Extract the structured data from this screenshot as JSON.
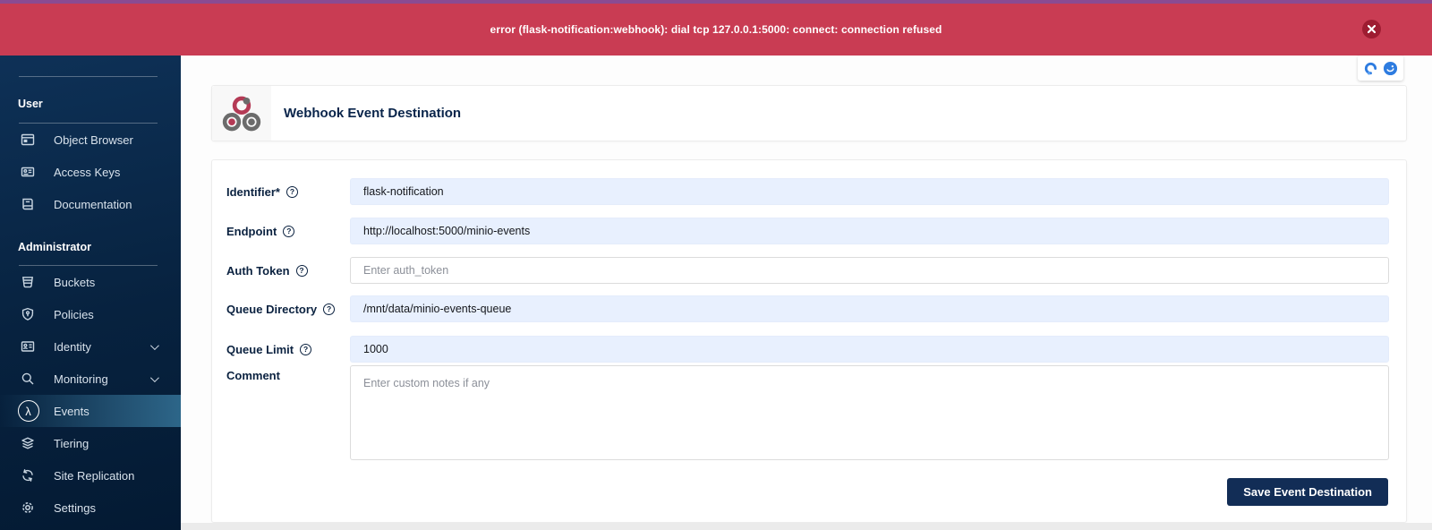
{
  "banner": {
    "message": "error (flask-notification:webhook): dial tcp 127.0.0.1:5000: connect: connection refused",
    "close_icon": "close-icon"
  },
  "sidebar": {
    "sections": [
      {
        "label": "User",
        "items": [
          {
            "label": "Object Browser",
            "icon": "object-browser-icon"
          },
          {
            "label": "Access Keys",
            "icon": "access-keys-icon"
          },
          {
            "label": "Documentation",
            "icon": "documentation-icon"
          }
        ]
      },
      {
        "label": "Administrator",
        "items": [
          {
            "label": "Buckets",
            "icon": "buckets-icon"
          },
          {
            "label": "Policies",
            "icon": "policies-icon"
          },
          {
            "label": "Identity",
            "icon": "identity-icon",
            "chevron": true
          },
          {
            "label": "Monitoring",
            "icon": "monitoring-icon",
            "chevron": true
          },
          {
            "label": "Events",
            "icon": "lambda-icon",
            "selected": true
          },
          {
            "label": "Tiering",
            "icon": "tiering-icon"
          },
          {
            "label": "Site Replication",
            "icon": "site-replication-icon"
          },
          {
            "label": "Settings",
            "icon": "settings-icon"
          }
        ]
      }
    ]
  },
  "header": {
    "title": "Webhook Event Destination",
    "icon": "webhook-icon"
  },
  "form": {
    "fields": [
      {
        "label": "Identifier*",
        "has_help": true,
        "value": "flask-notification",
        "filled": true
      },
      {
        "label": "Endpoint",
        "has_help": true,
        "value": "http://localhost:5000/minio-events",
        "filled": true
      },
      {
        "label": "Auth Token",
        "has_help": true,
        "value": "",
        "placeholder": "Enter auth_token",
        "filled": false
      },
      {
        "label": "Queue Directory",
        "has_help": true,
        "value": "/mnt/data/minio-events-queue",
        "filled": true
      },
      {
        "label": "Queue Limit",
        "has_help": true,
        "value": "1000",
        "filled": true
      },
      {
        "label": "Comment",
        "has_help": false,
        "value": "",
        "placeholder": "Enter custom notes if any",
        "type": "textarea"
      }
    ],
    "save_label": "Save Event Destination"
  },
  "browser_overlay": {
    "icons": [
      "extension-capture-icon",
      "extension-badge-icon"
    ]
  },
  "colors": {
    "top_strip_purple": "#8a4b92",
    "banner_red": "#c93c53",
    "banner_close_red": "#9e1c31",
    "sidebar_navy_top": "#0e3157",
    "sidebar_navy_bottom": "#041a33",
    "sidebar_selected_teal": "#2d6689",
    "label_navy": "#0b2240",
    "autofill_blue": "#e8f0fe",
    "button_navy": "#122d56",
    "webhook_red": "#b43a55",
    "webhook_gray": "#6b6b6b",
    "extension_blue": "#2e7ce0"
  }
}
